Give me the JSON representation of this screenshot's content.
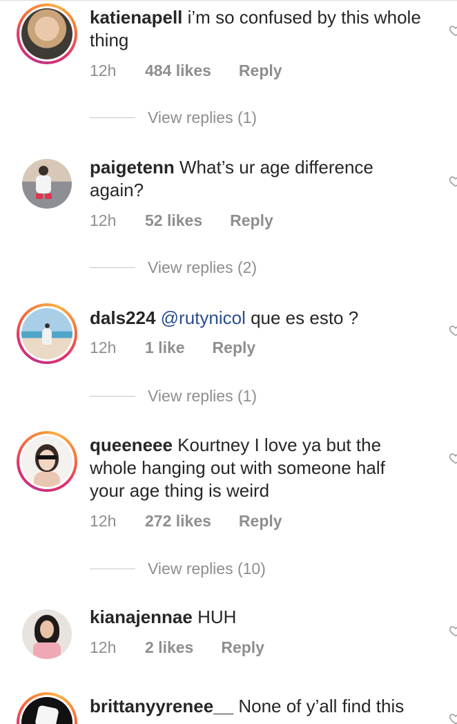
{
  "comments": [
    {
      "username": "katienapell",
      "text": " i’m so confused by this whole thing",
      "time": "12h",
      "likes": "484 likes",
      "reply": "Reply",
      "view_replies": "View replies (1)"
    },
    {
      "username": "paigetenn",
      "text": " What’s ur age difference again?",
      "time": "12h",
      "likes": "52 likes",
      "reply": "Reply",
      "view_replies": "View replies (2)"
    },
    {
      "username": "dals224",
      "mention": "@rutynicol",
      "text": " que es esto ?",
      "time": "12h",
      "likes": "1 like",
      "reply": "Reply",
      "view_replies": "View replies (1)"
    },
    {
      "username": "queeneee",
      "text": " Kourtney I love ya but the whole hanging out with someone half your age thing is weird",
      "time": "12h",
      "likes": "272 likes",
      "reply": "Reply",
      "view_replies": "View replies (10)"
    },
    {
      "username": "kianajennae",
      "text": " HUH",
      "time": "12h",
      "likes": "2 likes",
      "reply": "Reply"
    },
    {
      "username": "brittanyyrenee__",
      "text": " None of y’all find this"
    }
  ],
  "icons": {
    "like": "heart-outline-icon",
    "avatar": "profile-photo"
  },
  "colors": {
    "text": "#262626",
    "secondary": "#8e8e8e",
    "mention": "#2a4d8f",
    "story_ring": [
      "#c13584",
      "#e1306c",
      "#f77737",
      "#fcaf45"
    ]
  }
}
